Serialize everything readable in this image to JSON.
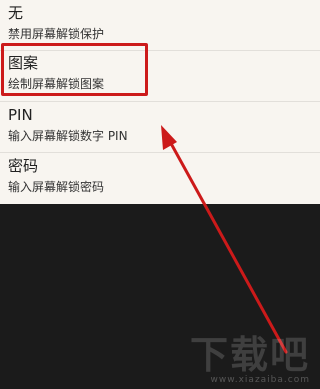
{
  "lock_options": [
    {
      "title": "无",
      "subtitle": "禁用屏幕解锁保护"
    },
    {
      "title": "图案",
      "subtitle": "绘制屏幕解锁图案"
    },
    {
      "title": "PIN",
      "subtitle": "输入屏幕解锁数字 PIN"
    },
    {
      "title": "密码",
      "subtitle": "输入屏幕解锁密码"
    }
  ],
  "annotation": {
    "color": "#cc1a1a",
    "highlighted_option": "图案"
  },
  "watermark": {
    "logo": "下载吧",
    "url": "www.xiazaiba.com"
  }
}
